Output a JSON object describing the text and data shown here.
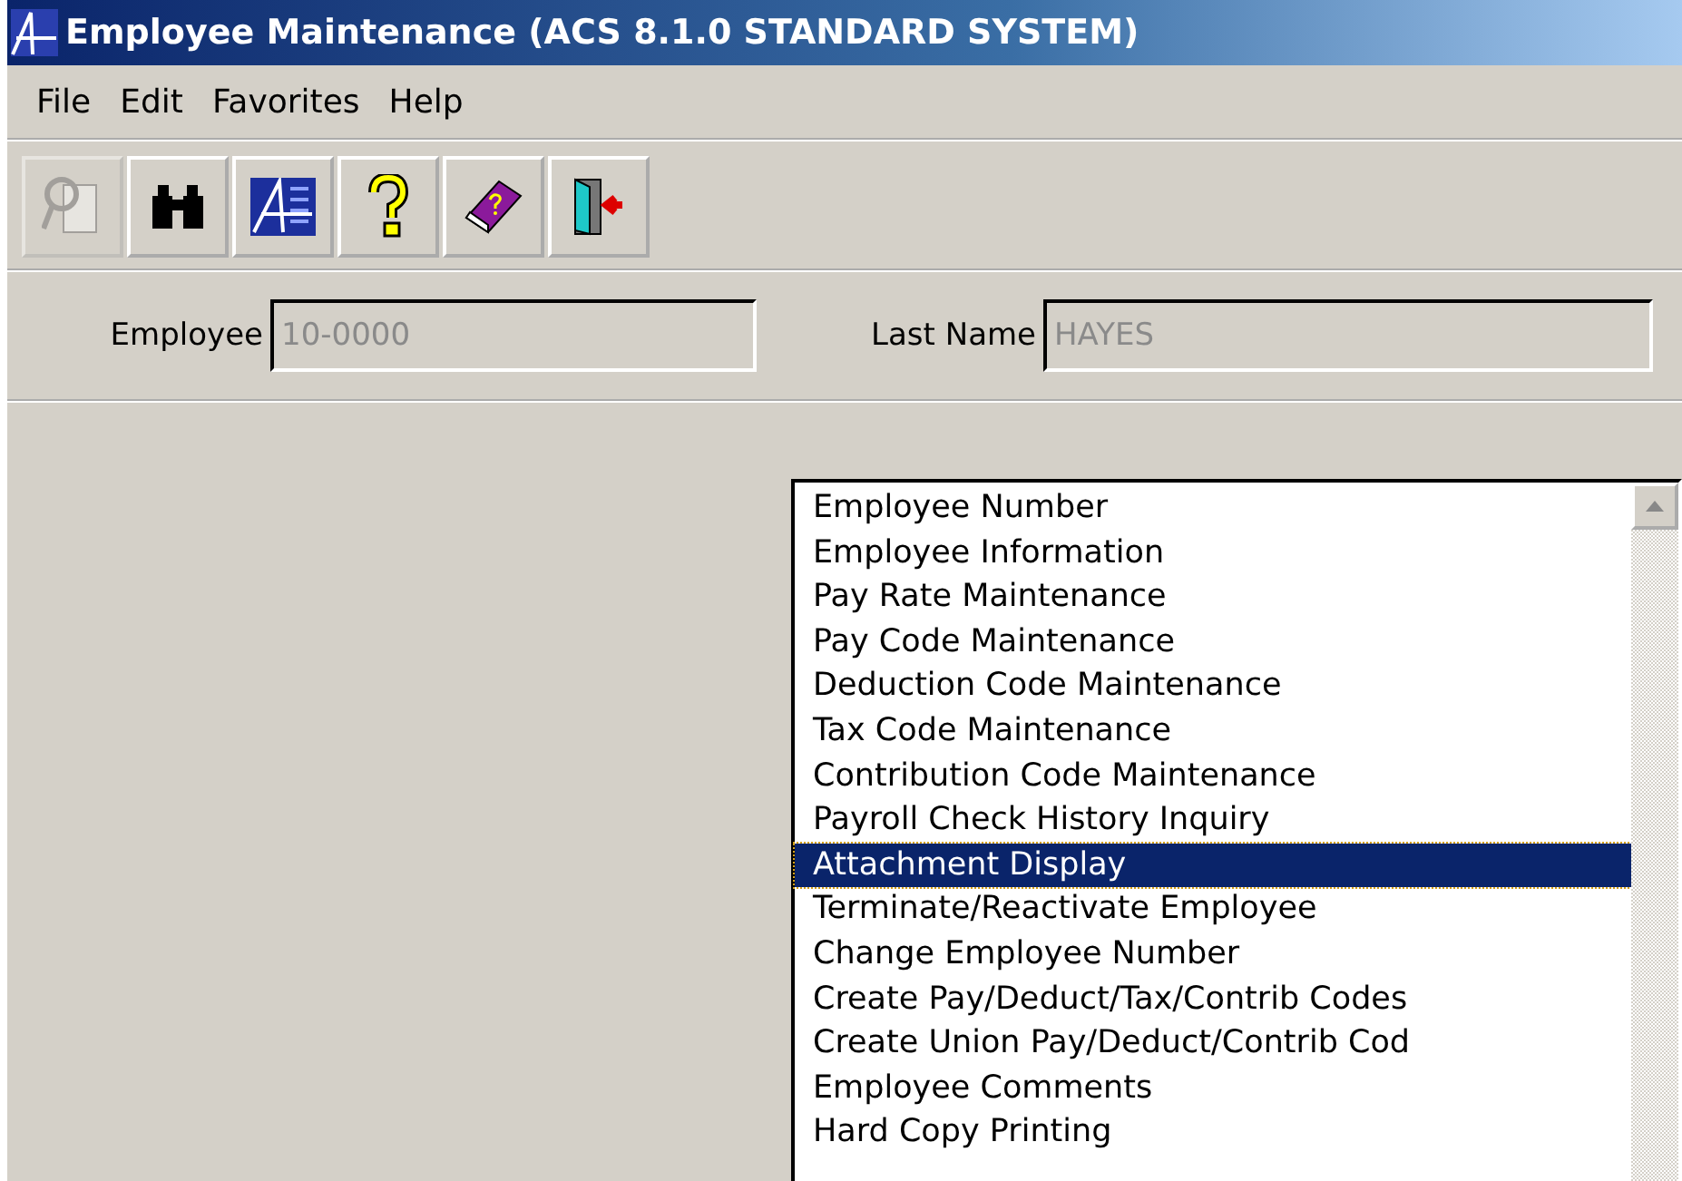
{
  "window": {
    "title": "Employee Maintenance (ACS 8.1.0 STANDARD SYSTEM)"
  },
  "menu": [
    "File",
    "Edit",
    "Favorites",
    "Help"
  ],
  "toolbar": [
    {
      "kind": "inquiry",
      "disabled": true
    },
    {
      "kind": "find",
      "disabled": false
    },
    {
      "kind": "logo",
      "disabled": false
    },
    {
      "kind": "help",
      "disabled": false
    },
    {
      "kind": "book",
      "disabled": false
    },
    {
      "kind": "exit",
      "disabled": false
    }
  ],
  "fields": [
    {
      "label": "Employee",
      "value": "10-0000",
      "disabled": true
    },
    {
      "label": "Last Name",
      "value": "HAYES",
      "disabled": true
    }
  ],
  "list": [
    {
      "label": "Employee Number",
      "selected": false
    },
    {
      "label": "Employee Information",
      "selected": false
    },
    {
      "label": "Pay Rate Maintenance",
      "selected": false
    },
    {
      "label": "Pay Code Maintenance",
      "selected": false
    },
    {
      "label": "Deduction Code Maintenance",
      "selected": false
    },
    {
      "label": "Tax Code Maintenance",
      "selected": false
    },
    {
      "label": "Contribution Code Maintenance",
      "selected": false
    },
    {
      "label": "Payroll Check History Inquiry",
      "selected": false
    },
    {
      "label": "Attachment Display",
      "selected": true
    },
    {
      "label": "Terminate/Reactivate Employee",
      "selected": false
    },
    {
      "label": "Change Employee Number",
      "selected": false
    },
    {
      "label": "Create Pay/Deduct/Tax/Contrib Codes",
      "selected": false
    },
    {
      "label": "Create Union Pay/Deduct/Contrib Cod",
      "selected": false
    },
    {
      "label": "Employee Comments",
      "selected": false
    },
    {
      "label": "Hard Copy Printing",
      "selected": false
    }
  ]
}
